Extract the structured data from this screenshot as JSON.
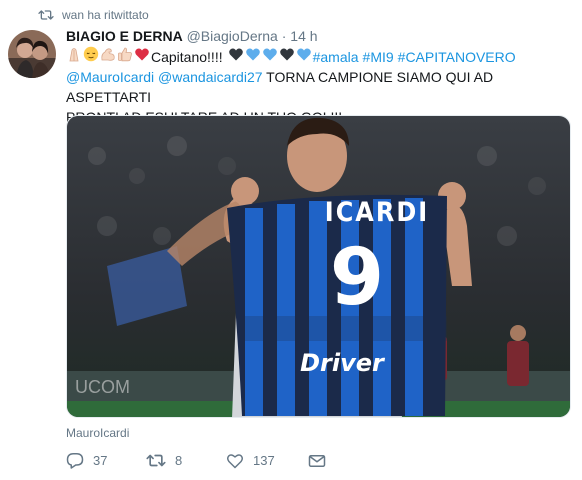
{
  "retweet_notice": "wan ha ritwittato",
  "tweet": {
    "author_name": "BIAGIO E DERNA",
    "author_handle": "@BiagioDerna",
    "separator": "·",
    "time": "14 h",
    "text_after_emoji": "Capitano!!!!",
    "hashtags": [
      "#amala",
      "#MI9",
      "#CAPITANOVERO"
    ],
    "mentions": [
      "@MauroIcardi",
      "@wandaicardi27"
    ],
    "text_line2": " TORNA CAMPIONE SIAMO QUI AD ASPETTARTI",
    "text_line3": "PRONTI AD ESULTARE AD UN TUO GOL!!!",
    "emoji_icons": [
      "folded-hands-icon",
      "relieved-face-icon",
      "flexed-biceps-icon",
      "thumbs-up-icon",
      "red-heart-icon",
      "black-heart-icon",
      "blue-heart-icon",
      "blue-heart-icon",
      "black-heart-icon",
      "blue-heart-icon"
    ]
  },
  "photo": {
    "shirt_name": "ICARDI",
    "shirt_number": "9",
    "sponsor": "Driver"
  },
  "photo_tag": "MauroIcardi",
  "actions": {
    "replies": "37",
    "retweets": "8",
    "likes": "137"
  },
  "colors": {
    "link": "#1b95e0",
    "secondary_text": "#657786",
    "jersey_blue": "#1f63c7",
    "heart_red": "#e0245e"
  }
}
